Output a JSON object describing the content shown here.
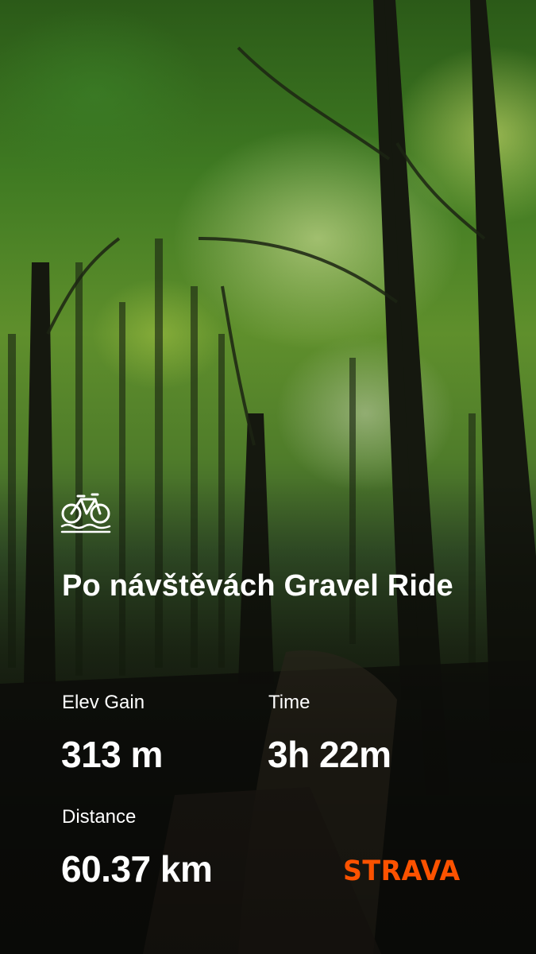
{
  "activity": {
    "icon": "bike-gravel-icon",
    "title": "Po návštěvách Gravel Ride"
  },
  "stats": {
    "elev_gain": {
      "label": "Elev Gain",
      "value": "313 m"
    },
    "time": {
      "label": "Time",
      "value": "3h 22m"
    },
    "distance": {
      "label": "Distance",
      "value": "60.37 km"
    }
  },
  "brand": {
    "logo_text": "STRAVA",
    "color": "#FC5200"
  },
  "background": {
    "icon": "forest-photo"
  }
}
